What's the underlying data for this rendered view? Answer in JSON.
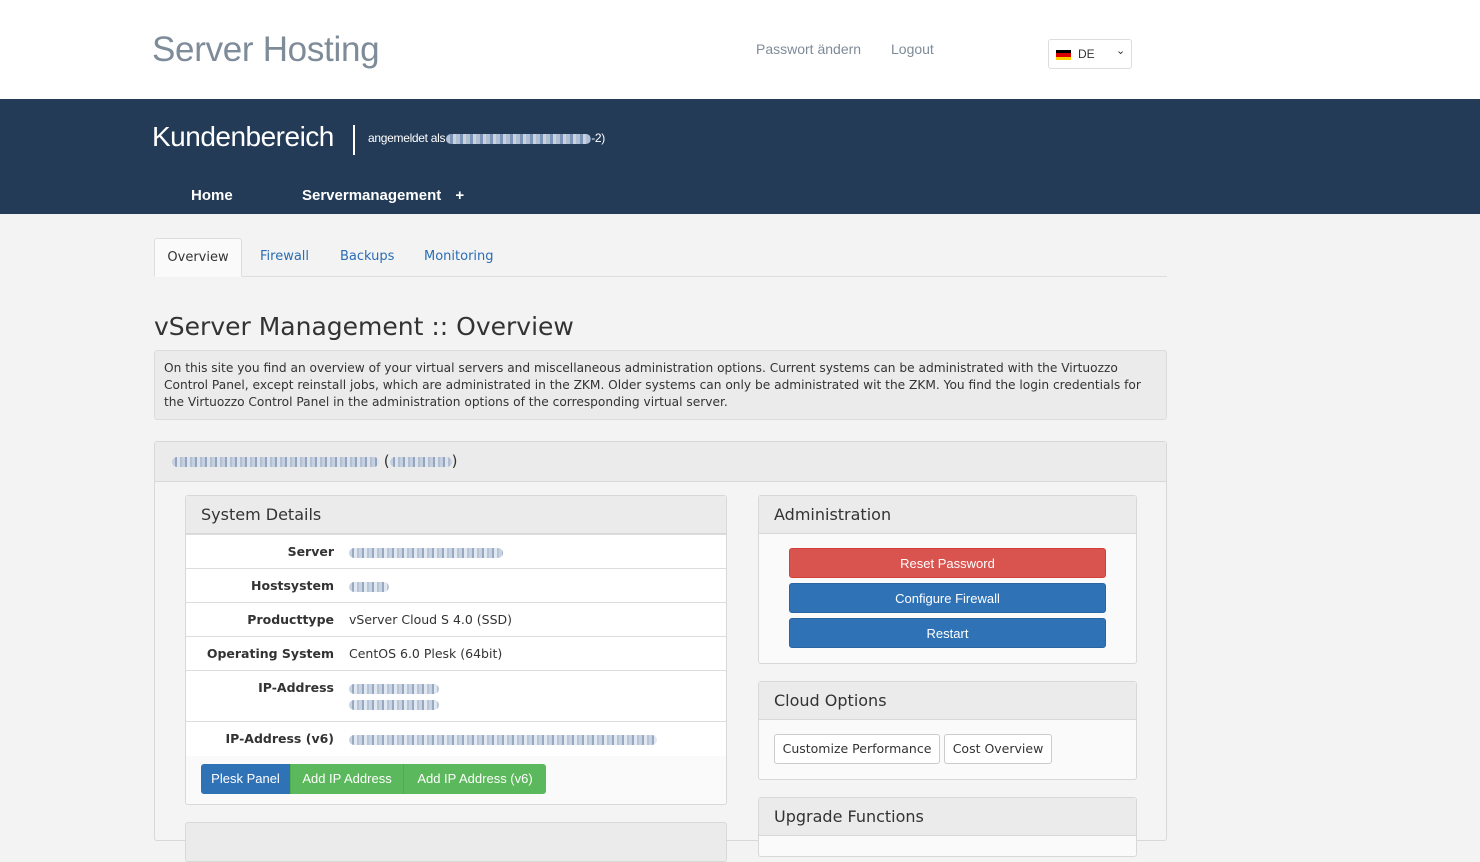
{
  "header": {
    "brand": "Server Hosting",
    "links": [
      "Passwort ändern",
      "Logout"
    ],
    "language": {
      "code": "DE",
      "flag_colors": [
        "#000000",
        "#dd0000",
        "#ffce00"
      ]
    }
  },
  "banner": {
    "title": "Kundenbereich",
    "logged_in_prefix": "angemeldet als",
    "logged_in_suffix": "-2)",
    "nav": [
      "Home",
      "Servermanagement"
    ],
    "nav_expand_icon": "+"
  },
  "tabs": [
    "Overview",
    "Firewall",
    "Backups",
    "Monitoring"
  ],
  "page_title": "vServer Management :: Overview",
  "info_text": "On this site you find an overview of your virtual servers and miscellaneous administration options. Current systems can be administrated with the Virtuozzo Control Panel, except reinstall jobs, which are administrated in the ZKM. Older systems can only be administrated wit the ZKM. You find the login credentials for the Virtuozzo Control Panel in the administration options of the corresponding virtual server.",
  "server_panel": {
    "system_details": {
      "title": "System Details",
      "rows": [
        {
          "label": "Server",
          "value": ""
        },
        {
          "label": "Hostsystem",
          "value": ""
        },
        {
          "label": "Producttype",
          "value": "vServer Cloud S 4.0 (SSD)"
        },
        {
          "label": "Operating System",
          "value": "CentOS 6.0 Plesk (64bit)"
        },
        {
          "label": "IP-Address",
          "value": ""
        },
        {
          "label": "IP-Address (v6)",
          "value": ""
        }
      ],
      "buttons": [
        "Plesk Panel",
        "Add IP Address",
        "Add IP Address (v6)"
      ]
    },
    "administration": {
      "title": "Administration",
      "buttons": [
        "Reset Password",
        "Configure Firewall",
        "Restart"
      ]
    },
    "cloud_options": {
      "title": "Cloud Options",
      "buttons": [
        "Customize Performance",
        "Cost Overview"
      ]
    },
    "upgrade_functions": {
      "title": "Upgrade Functions"
    }
  },
  "colors": {
    "navy": "#233b57",
    "danger": "#d9534f",
    "primary": "#2f72b6",
    "success": "#5cb85c",
    "link": "#2a6db5"
  }
}
